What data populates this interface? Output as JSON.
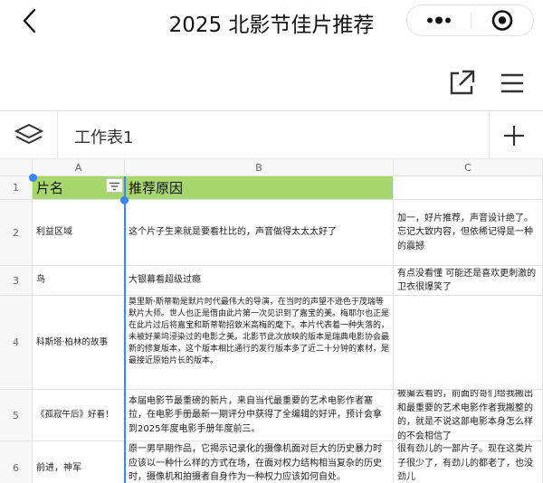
{
  "app": {
    "title": "2025 北影节佳片推荐"
  },
  "icons": {
    "back": "chevron-left-icon",
    "more": "more-dots-icon",
    "close": "target-close-icon",
    "share": "share-external-icon",
    "menu": "hamburger-menu-icon",
    "layers": "layers-icon",
    "add": "plus-icon",
    "filter": "filter-icon"
  },
  "colors": {
    "header_fill": "#a7d66d",
    "selection": "#3a86ff"
  },
  "sheet": {
    "tab_label": "工作表1"
  },
  "columns": [
    "A",
    "B",
    "C"
  ],
  "rows": [
    {
      "num": "1",
      "a": "片名",
      "b": "推荐原因",
      "c": ""
    },
    {
      "num": "2",
      "a": "利益区域",
      "b": "这个片子生来就是要看杜比的，声音做得太太太好了",
      "c": "加一，好片推荐，声音设计绝了。忘记大致内容，但依稀记得是一种的震撼"
    },
    {
      "num": "3",
      "a": "鸟",
      "b": "大银幕看超级过瘾",
      "c": "有点没看懂 可能还是喜欢更刺激的卫衣很爆笑了"
    },
    {
      "num": "4",
      "a": "科斯塔·柏林的故事",
      "b": "莫里斯·斯蒂勒是默片时代最伟大的导演，在当时的声望不逊色于茂瑞等默片大师。世人也正是借由此片第一次见识到了嘉宝的美。梅耶尔也正是在此片过后将嘉宝和斯蒂勒招致米高梅的麾下。本片代表着一种失落的，未被好莱坞浸染过的电影之美。北影节此次放映的版本是瑞典电影协会最新的修复版本，这个版本相比通行的发行版本多了近二十分钟的素材，是最接近原始片长的版本。",
      "c": ""
    },
    {
      "num": "5",
      "a": "《孤寂午后》好看！",
      "b": "本届电影节最重磅的新片，来自当代最重要的艺术电影作者塞拉，在电影手册最新一期评分中获得了全编辑的好评，预计会拿到2025年度电影手册年度前三。",
      "c": "被骗去看的，前面的哥们给我搬出和最重要的艺术电影作者我搬整的的，就是不说这部电影本身怎么样的不会相信了"
    },
    {
      "num": "6",
      "a": "前进，神军",
      "b": "原一男早期作品，它揭示记录化的摄像机面对巨大的历史暴力时应该以一种什么样的方式在场，在面对权力结构相当复杂的历史时，摄像机和拍摄者自身作为一种权力应该如何自处。",
      "c": "很有劲儿的一部片子。现在这类片子很少了，有劲儿的都老了，也没劲儿"
    }
  ]
}
